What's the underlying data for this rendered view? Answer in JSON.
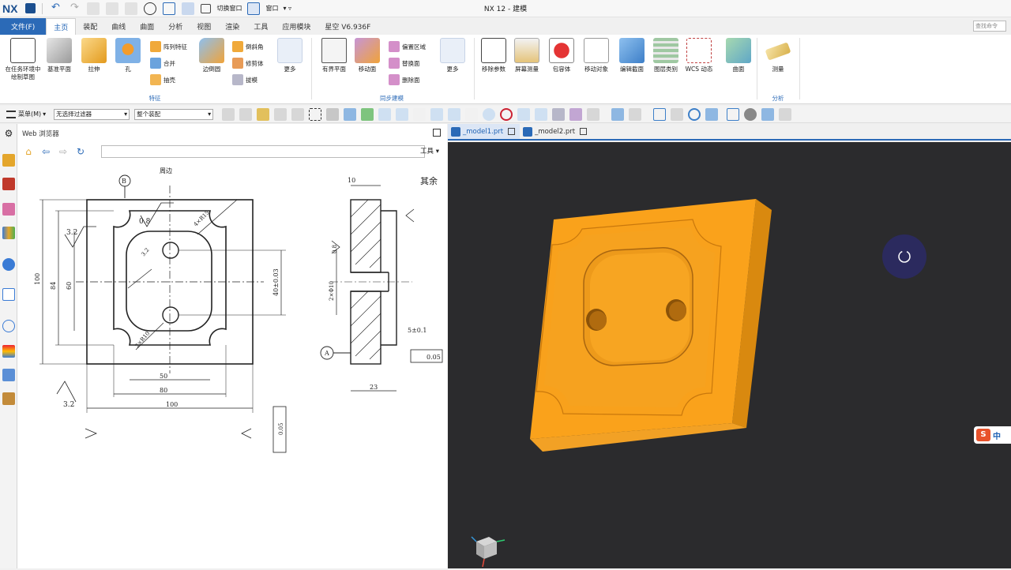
{
  "app": {
    "logo": "NX",
    "window_title": "NX 12 - 建模",
    "quick_access": {
      "switch_window": "切换窗口",
      "window": "窗口"
    },
    "command_search_placeholder": "查找命令"
  },
  "tabs": [
    "文件(F)",
    "主页",
    "装配",
    "曲线",
    "曲面",
    "分析",
    "视图",
    "渲染",
    "工具",
    "应用模块",
    "星空 V6.936F"
  ],
  "active_tab": "主页",
  "ribbon": {
    "feature_group": {
      "label": "特征",
      "big": [
        "在任务环境中绘制草图",
        "基准平面",
        "拉伸",
        "孔",
        "边倒圆",
        "更多"
      ],
      "small": [
        "阵列特征",
        "合并",
        "抽壳",
        "倒斜角",
        "修剪体",
        "拔模"
      ]
    },
    "sync_group": {
      "label": "同步建模",
      "big": [
        "有界平面",
        "移动面",
        "更多"
      ],
      "small": [
        "偏置区域",
        "替换面",
        "删除面"
      ]
    },
    "misc_group": {
      "big": [
        "移除参数",
        "屏幕测量",
        "包容体",
        "移动对象",
        "编辑截面",
        "图层类别",
        "WCS 动态",
        "曲面"
      ]
    },
    "analysis_group": {
      "label": "分析",
      "big": [
        "测量"
      ]
    }
  },
  "toolbar2": {
    "menu_label": "菜单(M)",
    "filter_value": "无选择过滤器",
    "scope_value": "整个装配"
  },
  "web_browser": {
    "title": "Web 浏览器",
    "url_value": "",
    "tools_label": "工具",
    "drawing": {
      "roughness_top": "3.2",
      "roughness_bottom": "3.2",
      "roughness_b": "0.8",
      "datum_b": "B",
      "weizhi": "周边",
      "r15_label": "4×R15",
      "chamfer_label": "3.2",
      "r10_label": "2×R10",
      "qita": "其余",
      "dim_100_v": "100",
      "dim_84": "84",
      "dim_60": "60",
      "dim_40": "40±0.03",
      "dim_50": "50",
      "dim_80": "80",
      "dim_100_h": "100",
      "dim_10": "10",
      "dim_5": "5±0.1",
      "dim_holes": "2×Φ10",
      "dim_23": "23",
      "datum_a": "A",
      "tol_parallel": "0.05",
      "tol_b": "0.05",
      "roughness_side": "0.8"
    }
  },
  "graphics": {
    "view_tabs": [
      "_model1.prt",
      "_model2.prt"
    ],
    "active_view_tab": "_model1.prt",
    "part_color": "#FAA21B",
    "background": "#2b2b2d",
    "ime_label": "中"
  }
}
